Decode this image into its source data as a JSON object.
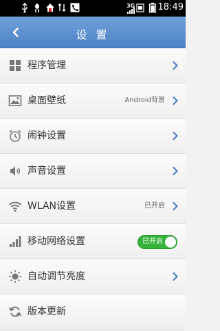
{
  "status_bar": {
    "time": "18:49",
    "network_label": "3G",
    "icons": [
      "usb-icon",
      "usb-debug-icon",
      "home-icon",
      "data-transfer-icon",
      "phone-icon",
      "signal-icon",
      "sim-icon",
      "battery-icon"
    ]
  },
  "title_bar": {
    "title": "设 置"
  },
  "rows": [
    {
      "label": "程序管理",
      "value": "",
      "icon": "apps-icon",
      "chevron": true
    },
    {
      "label": "桌面壁纸",
      "value": "Android背景",
      "icon": "wallpaper-icon",
      "chevron": true
    },
    {
      "label": "闹钟设置",
      "value": "",
      "icon": "alarm-icon",
      "chevron": true
    },
    {
      "label": "声音设置",
      "value": "",
      "icon": "sound-icon",
      "chevron": true
    },
    {
      "label": "WLAN设置",
      "value": "已开启",
      "icon": "wifi-icon",
      "chevron": true
    },
    {
      "label": "移动网络设置",
      "value": "",
      "icon": "mobile-network-icon",
      "toggle_label": "已开启",
      "toggle_on": true
    },
    {
      "label": "自动调节亮度",
      "value": "",
      "icon": "brightness-icon",
      "chevron": true
    },
    {
      "label": "版本更新",
      "value": "",
      "icon": "update-icon",
      "chevron": false
    }
  ],
  "colors": {
    "title_bar": "#5a8fd2",
    "chevron": "#4f7fc4",
    "toggle_on": "#35b43b"
  }
}
